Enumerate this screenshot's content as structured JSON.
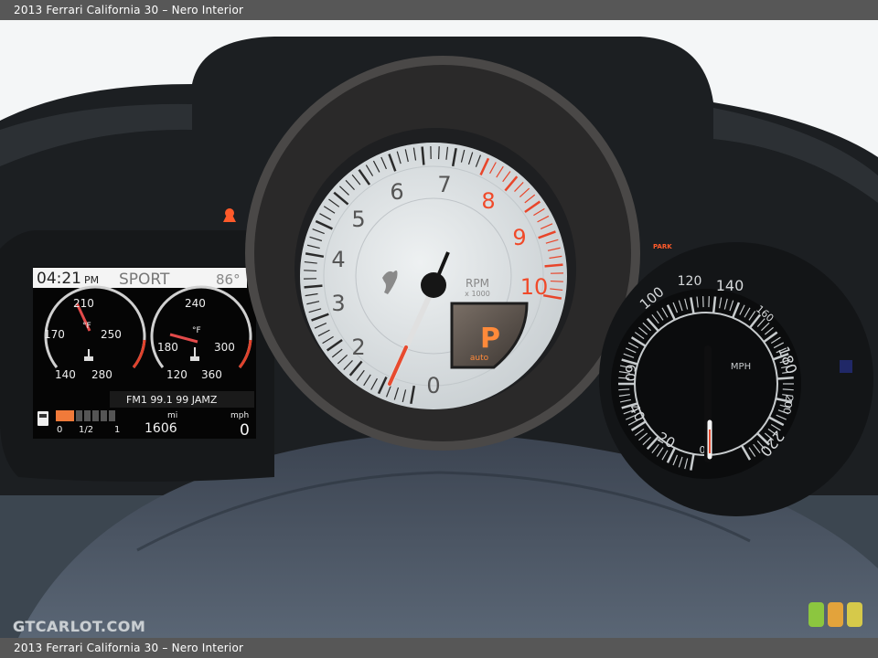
{
  "caption": "2013 Ferrari California 30 – Nero Interior",
  "watermark": "GTCARLOT.COM",
  "badge_colors": [
    "#8cc63f",
    "#e3a33b",
    "#d6c94a"
  ],
  "tachometer": {
    "numbers": [
      "0",
      "2",
      "3",
      "4",
      "5",
      "6",
      "7",
      "8",
      "9",
      "10"
    ],
    "rpm_label": "RPM",
    "rpm_unit": "x 1000",
    "gear": "P",
    "gear_mode": "auto"
  },
  "speedometer": {
    "numbers": [
      "0",
      "20",
      "40",
      "60",
      "100",
      "120",
      "140",
      "160",
      "180",
      "200",
      "220"
    ],
    "unit": "MPH"
  },
  "display": {
    "time": "04:21",
    "ampm": "PM",
    "mode": "SPORT",
    "outside_temp": "86°",
    "gauge_left": {
      "top": "210",
      "left": "170",
      "right": "250",
      "bottom_left": "140",
      "bottom_right": "280",
      "unit": "°F"
    },
    "gauge_right": {
      "top": "240",
      "left": "180",
      "right": "300",
      "bottom_left": "120",
      "bottom_right": "360",
      "unit": "°F"
    },
    "radio": "FM1 99.1 99 JAMZ",
    "fuel_labels": [
      "0",
      "1/2",
      "1"
    ],
    "odometer_unit": "mi",
    "odometer": "1606",
    "speed_unit": "mph",
    "speed": "0"
  },
  "park_label": "PARK"
}
